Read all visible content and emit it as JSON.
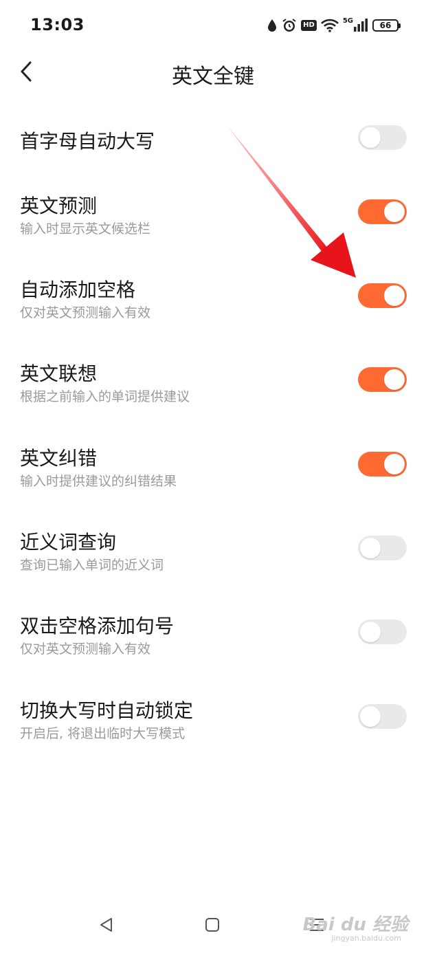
{
  "status_bar": {
    "time": "13:03",
    "battery": "66",
    "hd_label": "HD",
    "network_label": "5G",
    "icons": [
      "drop-icon",
      "alarm-icon",
      "hd-icon",
      "wifi-icon",
      "signal-icon",
      "battery-icon"
    ]
  },
  "header": {
    "title": "英文全键",
    "back_icon": "chevron-left-icon"
  },
  "colors": {
    "toggle_on": "#ff6a33",
    "toggle_off": "#e9e9e9",
    "subtitle": "#9a9a9a",
    "annotation_arrow": "#e8141b"
  },
  "settings": [
    {
      "title": "首字母自动大写",
      "subtitle": "",
      "enabled": false
    },
    {
      "title": "英文预测",
      "subtitle": "输入时显示英文候选栏",
      "enabled": true
    },
    {
      "title": "自动添加空格",
      "subtitle": "仅对英文预测输入有效",
      "enabled": true
    },
    {
      "title": "英文联想",
      "subtitle": "根据之前输入的单词提供建议",
      "enabled": true
    },
    {
      "title": "英文纠错",
      "subtitle": "输入时提供建议的纠错结果",
      "enabled": true
    },
    {
      "title": "近义词查询",
      "subtitle": "查询已输入单词的近义词",
      "enabled": false
    },
    {
      "title": "双击空格添加句号",
      "subtitle": "仅对英文预测输入有效",
      "enabled": false
    },
    {
      "title": "切换大写时自动锁定",
      "subtitle": "开启后, 将退出临时大写模式",
      "enabled": false
    }
  ],
  "nav_bar": {
    "icons": [
      "back-triangle-icon",
      "home-square-icon",
      "menu-lines-icon"
    ]
  },
  "watermark": {
    "text": "Bai du 经验",
    "sub": "jingyan.baidu.com"
  }
}
